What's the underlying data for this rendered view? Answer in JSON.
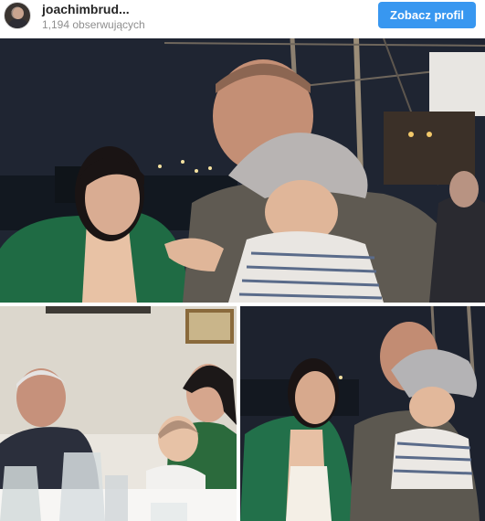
{
  "profile": {
    "username": "joachimbrud...",
    "followers": "1,194 obserwujących",
    "follow_button": "Zobacz profil",
    "avatar_icon": "profile-avatar"
  },
  "colors": {
    "button": "#3897f0",
    "username": "#262626",
    "secondary": "#8e8e8e"
  },
  "photos": [
    {
      "name": "photo-night-harbor-family"
    },
    {
      "name": "photo-dinner-table"
    },
    {
      "name": "photo-night-harbor-family-2"
    }
  ]
}
